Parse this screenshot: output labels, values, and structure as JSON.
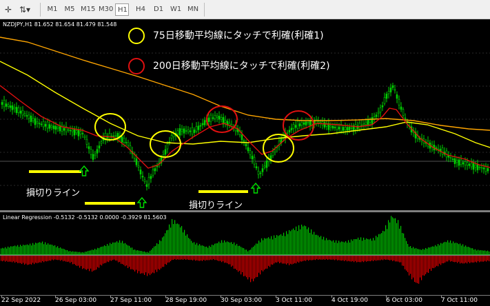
{
  "toolbar": {
    "timeframes": [
      "M1",
      "M5",
      "M15",
      "M30",
      "H1",
      "H4",
      "D1",
      "W1",
      "MN"
    ],
    "active": "H1",
    "tools": [
      "crosshair-tool",
      "period-selector-tool"
    ]
  },
  "chart": {
    "info": "NZDJPY,H1  81.652 81.654 81.479 81.548",
    "legend": [
      {
        "text": "75日移動平均線にタッチで利確(利確1)",
        "color": "#ffff00"
      },
      {
        "text": "200日移動平均線にタッチで利確(利確2)",
        "color": "#e01010"
      }
    ],
    "stoploss_label": "損切りライン",
    "ma_colors": {
      "ma_short": "#e01010",
      "ma_75": "#ffff00",
      "ma_200": "#ffa500"
    }
  },
  "subwindow": {
    "info": "Linear Regression  -0.5132 -0.5132 0.0000 -0.3929 81.5603",
    "colors": {
      "up": "#00c800",
      "down": "#e00000"
    }
  },
  "xaxis": {
    "labels": [
      "22 Sep 2022",
      "26 Sep 03:00",
      "27 Sep 11:00",
      "28 Sep 19:00",
      "30 Sep 03:00",
      "3 Oct 11:00",
      "4 Oct 19:00",
      "6 Oct 03:00",
      "7 Oct 11:00"
    ]
  }
}
